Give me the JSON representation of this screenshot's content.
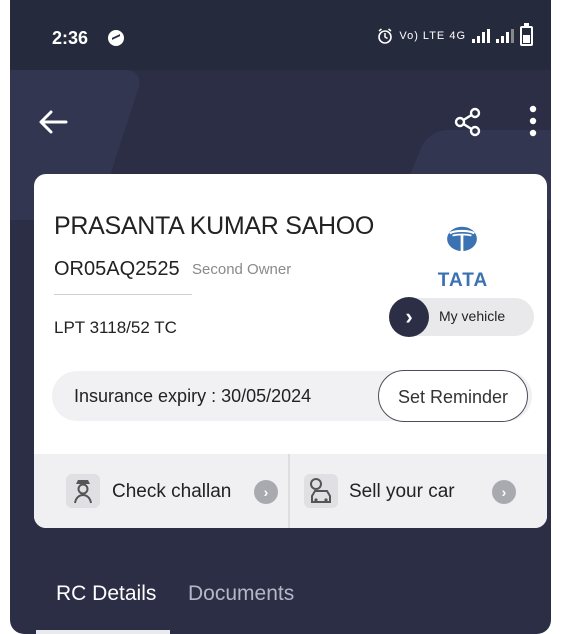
{
  "status_bar": {
    "time": "2:36",
    "network": "Vo) LTE 4G"
  },
  "toolbar": {
    "back_icon": "arrow-left-icon",
    "share_icon": "share-icon",
    "more_icon": "more-vertical-icon"
  },
  "vehicle": {
    "owner_name": "PRASANTA KUMAR SAHOO",
    "registration": "OR05AQ2525",
    "owner_type": "Second Owner",
    "model": "LPT 3118/52 TC",
    "brand": "TATA",
    "my_vehicle_label": "My vehicle"
  },
  "insurance": {
    "text": "Insurance expiry : 30/05/2024",
    "reminder_label": "Set Reminder"
  },
  "actions": [
    {
      "label": "Check challan",
      "icon": "traffic-police-icon"
    },
    {
      "label": "Sell your car",
      "icon": "car-sale-icon"
    }
  ],
  "tabs": [
    {
      "label": "RC Details",
      "active": true
    },
    {
      "label": "Documents",
      "active": false
    }
  ],
  "colors": {
    "background": "#2b2e44",
    "brand_blue": "#3a72b3"
  }
}
